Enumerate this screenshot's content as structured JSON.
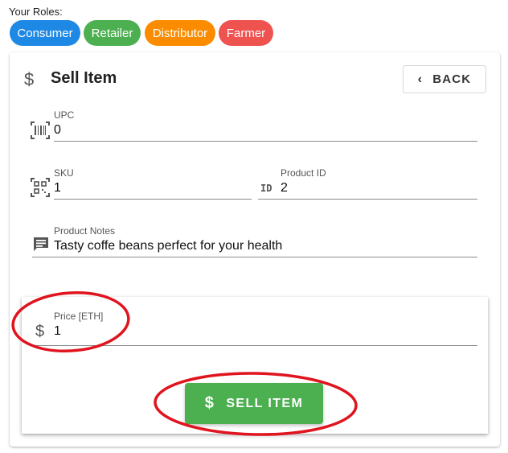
{
  "roles": {
    "label": "Your Roles:",
    "chips": [
      {
        "label": "Consumer",
        "color": "#1e88e5"
      },
      {
        "label": "Retailer",
        "color": "#4caf50"
      },
      {
        "label": "Distributor",
        "color": "#fb8c00"
      },
      {
        "label": "Farmer",
        "color": "#ef5350"
      }
    ]
  },
  "card": {
    "title": "Sell Item",
    "title_icon": "dollar-icon",
    "back_label": "BACK"
  },
  "fields": {
    "upc": {
      "label": "UPC",
      "value": "0",
      "icon": "barcode-icon"
    },
    "sku": {
      "label": "SKU",
      "value": "1",
      "icon": "qr-code-icon"
    },
    "product_id": {
      "label": "Product ID",
      "value": "2",
      "icon_text": "ID"
    },
    "product_notes": {
      "label": "Product Notes",
      "value": "Tasty coffe beans perfect for your health",
      "icon": "notes-icon"
    },
    "price": {
      "label": "Price [ETH]",
      "value": "1",
      "icon": "dollar-icon"
    }
  },
  "actions": {
    "sell_label": "SELL ITEM"
  },
  "colors": {
    "sell_button": "#4caf50",
    "annotation_red": "#e0141e"
  }
}
